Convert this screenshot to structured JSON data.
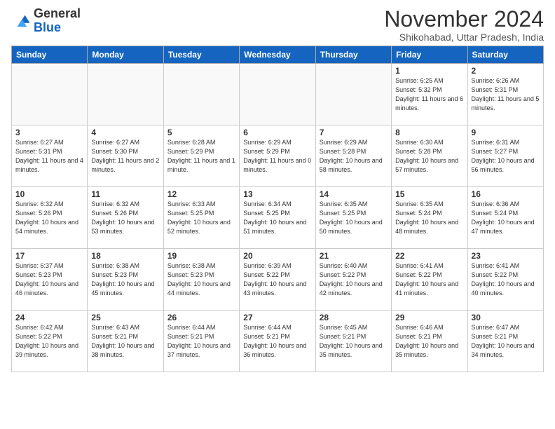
{
  "logo": {
    "general": "General",
    "blue": "Blue"
  },
  "header": {
    "month": "November 2024",
    "location": "Shikohabad, Uttar Pradesh, India"
  },
  "weekdays": [
    "Sunday",
    "Monday",
    "Tuesday",
    "Wednesday",
    "Thursday",
    "Friday",
    "Saturday"
  ],
  "weeks": [
    [
      {
        "day": "",
        "info": ""
      },
      {
        "day": "",
        "info": ""
      },
      {
        "day": "",
        "info": ""
      },
      {
        "day": "",
        "info": ""
      },
      {
        "day": "",
        "info": ""
      },
      {
        "day": "1",
        "info": "Sunrise: 6:25 AM\nSunset: 5:32 PM\nDaylight: 11 hours\nand 6 minutes."
      },
      {
        "day": "2",
        "info": "Sunrise: 6:26 AM\nSunset: 5:31 PM\nDaylight: 11 hours\nand 5 minutes."
      }
    ],
    [
      {
        "day": "3",
        "info": "Sunrise: 6:27 AM\nSunset: 5:31 PM\nDaylight: 11 hours\nand 4 minutes."
      },
      {
        "day": "4",
        "info": "Sunrise: 6:27 AM\nSunset: 5:30 PM\nDaylight: 11 hours\nand 2 minutes."
      },
      {
        "day": "5",
        "info": "Sunrise: 6:28 AM\nSunset: 5:29 PM\nDaylight: 11 hours\nand 1 minute."
      },
      {
        "day": "6",
        "info": "Sunrise: 6:29 AM\nSunset: 5:29 PM\nDaylight: 11 hours\nand 0 minutes."
      },
      {
        "day": "7",
        "info": "Sunrise: 6:29 AM\nSunset: 5:28 PM\nDaylight: 10 hours\nand 58 minutes."
      },
      {
        "day": "8",
        "info": "Sunrise: 6:30 AM\nSunset: 5:28 PM\nDaylight: 10 hours\nand 57 minutes."
      },
      {
        "day": "9",
        "info": "Sunrise: 6:31 AM\nSunset: 5:27 PM\nDaylight: 10 hours\nand 56 minutes."
      }
    ],
    [
      {
        "day": "10",
        "info": "Sunrise: 6:32 AM\nSunset: 5:26 PM\nDaylight: 10 hours\nand 54 minutes."
      },
      {
        "day": "11",
        "info": "Sunrise: 6:32 AM\nSunset: 5:26 PM\nDaylight: 10 hours\nand 53 minutes."
      },
      {
        "day": "12",
        "info": "Sunrise: 6:33 AM\nSunset: 5:25 PM\nDaylight: 10 hours\nand 52 minutes."
      },
      {
        "day": "13",
        "info": "Sunrise: 6:34 AM\nSunset: 5:25 PM\nDaylight: 10 hours\nand 51 minutes."
      },
      {
        "day": "14",
        "info": "Sunrise: 6:35 AM\nSunset: 5:25 PM\nDaylight: 10 hours\nand 50 minutes."
      },
      {
        "day": "15",
        "info": "Sunrise: 6:35 AM\nSunset: 5:24 PM\nDaylight: 10 hours\nand 48 minutes."
      },
      {
        "day": "16",
        "info": "Sunrise: 6:36 AM\nSunset: 5:24 PM\nDaylight: 10 hours\nand 47 minutes."
      }
    ],
    [
      {
        "day": "17",
        "info": "Sunrise: 6:37 AM\nSunset: 5:23 PM\nDaylight: 10 hours\nand 46 minutes."
      },
      {
        "day": "18",
        "info": "Sunrise: 6:38 AM\nSunset: 5:23 PM\nDaylight: 10 hours\nand 45 minutes."
      },
      {
        "day": "19",
        "info": "Sunrise: 6:38 AM\nSunset: 5:23 PM\nDaylight: 10 hours\nand 44 minutes."
      },
      {
        "day": "20",
        "info": "Sunrise: 6:39 AM\nSunset: 5:22 PM\nDaylight: 10 hours\nand 43 minutes."
      },
      {
        "day": "21",
        "info": "Sunrise: 6:40 AM\nSunset: 5:22 PM\nDaylight: 10 hours\nand 42 minutes."
      },
      {
        "day": "22",
        "info": "Sunrise: 6:41 AM\nSunset: 5:22 PM\nDaylight: 10 hours\nand 41 minutes."
      },
      {
        "day": "23",
        "info": "Sunrise: 6:41 AM\nSunset: 5:22 PM\nDaylight: 10 hours\nand 40 minutes."
      }
    ],
    [
      {
        "day": "24",
        "info": "Sunrise: 6:42 AM\nSunset: 5:22 PM\nDaylight: 10 hours\nand 39 minutes."
      },
      {
        "day": "25",
        "info": "Sunrise: 6:43 AM\nSunset: 5:21 PM\nDaylight: 10 hours\nand 38 minutes."
      },
      {
        "day": "26",
        "info": "Sunrise: 6:44 AM\nSunset: 5:21 PM\nDaylight: 10 hours\nand 37 minutes."
      },
      {
        "day": "27",
        "info": "Sunrise: 6:44 AM\nSunset: 5:21 PM\nDaylight: 10 hours\nand 36 minutes."
      },
      {
        "day": "28",
        "info": "Sunrise: 6:45 AM\nSunset: 5:21 PM\nDaylight: 10 hours\nand 35 minutes."
      },
      {
        "day": "29",
        "info": "Sunrise: 6:46 AM\nSunset: 5:21 PM\nDaylight: 10 hours\nand 35 minutes."
      },
      {
        "day": "30",
        "info": "Sunrise: 6:47 AM\nSunset: 5:21 PM\nDaylight: 10 hours\nand 34 minutes."
      }
    ]
  ]
}
